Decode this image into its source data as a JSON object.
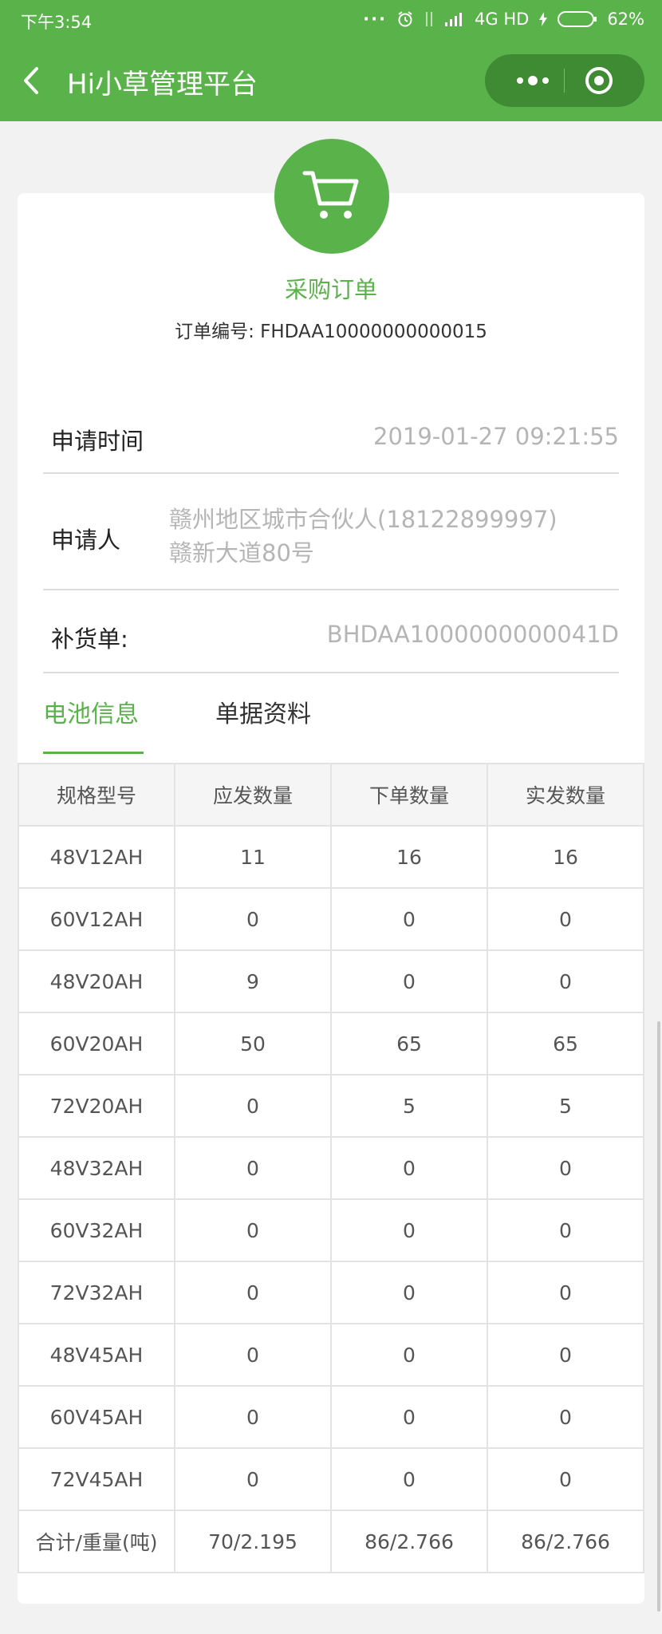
{
  "status_bar": {
    "time": "下午3:54",
    "network": "4G HD",
    "battery": "62%"
  },
  "nav": {
    "title": "Hi小草管理平台"
  },
  "order": {
    "type": "采购订单",
    "number_label": "订单编号:",
    "number": "FHDAA10000000000015"
  },
  "fields": {
    "apply_time_label": "申请时间",
    "apply_time": "2019-01-27 09:21:55",
    "applicant_label": "申请人",
    "applicant_line1": "赣州地区城市合伙人(18122899997)",
    "applicant_line2": "赣新大道80号",
    "restock_label": "补货单:",
    "restock": "BHDAA1000000000041D"
  },
  "tabs": [
    {
      "label": "电池信息",
      "active": true
    },
    {
      "label": "单据资料",
      "active": false
    }
  ],
  "table": {
    "headers": [
      "规格型号",
      "应发数量",
      "下单数量",
      "实发数量"
    ],
    "rows": [
      [
        "48V12AH",
        "11",
        "16",
        "16"
      ],
      [
        "60V12AH",
        "0",
        "0",
        "0"
      ],
      [
        "48V20AH",
        "9",
        "0",
        "0"
      ],
      [
        "60V20AH",
        "50",
        "65",
        "65"
      ],
      [
        "72V20AH",
        "0",
        "5",
        "5"
      ],
      [
        "48V32AH",
        "0",
        "0",
        "0"
      ],
      [
        "60V32AH",
        "0",
        "0",
        "0"
      ],
      [
        "72V32AH",
        "0",
        "0",
        "0"
      ],
      [
        "48V45AH",
        "0",
        "0",
        "0"
      ],
      [
        "60V45AH",
        "0",
        "0",
        "0"
      ],
      [
        "72V45AH",
        "0",
        "0",
        "0"
      ],
      [
        "合计/重量(吨)",
        "70/2.195",
        "86/2.766",
        "86/2.766"
      ]
    ]
  },
  "colors": {
    "brand_green": "#5ab34a",
    "capsule": "#3f8b33"
  },
  "icons": [
    "back-icon",
    "more-icon",
    "target-icon",
    "cart-icon",
    "alarm-icon",
    "signal-icon",
    "battery-icon"
  ]
}
